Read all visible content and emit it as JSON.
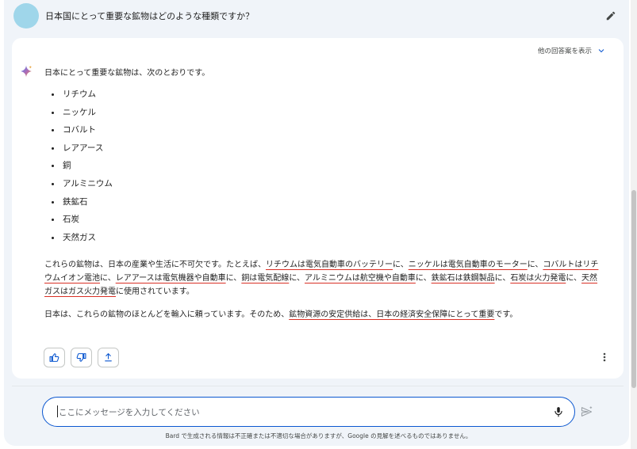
{
  "prompt": {
    "text": "日本国にとって重要な鉱物はどのような種類ですか？"
  },
  "response": {
    "show_drafts_label": "他の回答案を表示",
    "intro": "日本にとって重要な鉱物は、次のとおりです。",
    "minerals": [
      "リチウム",
      "ニッケル",
      "コバルト",
      "レアアース",
      "銅",
      "アルミニウム",
      "鉄鉱石",
      "石炭",
      "天然ガス"
    ],
    "para1": [
      {
        "t": "これらの鉱物は、日本の産業や生活に不可欠です。たとえば、",
        "u": false
      },
      {
        "t": "リチウムは電気自動車のバッテリー",
        "u": true
      },
      {
        "t": "に、",
        "u": false
      },
      {
        "t": "ニッケルは電気自動車のモーター",
        "u": true
      },
      {
        "t": "に、",
        "u": false
      },
      {
        "t": "コバルトはリチウムイオン電池",
        "u": true
      },
      {
        "t": "に、",
        "u": false
      },
      {
        "t": "レアアースは電気機器や自動車",
        "u": true
      },
      {
        "t": "に、",
        "u": false
      },
      {
        "t": "銅は電気配線",
        "u": true
      },
      {
        "t": "に、",
        "u": false
      },
      {
        "t": "アルミニウムは航空機や自動車",
        "u": true
      },
      {
        "t": "に、",
        "u": false
      },
      {
        "t": "鉄鉱石は鉄鋼製品",
        "u": true
      },
      {
        "t": "に、",
        "u": false
      },
      {
        "t": "石炭は火力発電",
        "u": true
      },
      {
        "t": "に、",
        "u": false
      },
      {
        "t": "天然ガスはガス火力発電",
        "u": true
      },
      {
        "t": "に使用されています。",
        "u": false
      }
    ],
    "para2": [
      {
        "t": "日本は、これらの鉱物のほとんどを輸入に頼っています。そのため、",
        "u": false
      },
      {
        "t": "鉱物資源の安定供給は、日本の経済安全保障にとって重要",
        "u": true
      },
      {
        "t": "です。",
        "u": false
      }
    ]
  },
  "input": {
    "placeholder": "ここにメッセージを入力してください"
  },
  "disclaimer": "Bard で生成される情報は不正確または不適切な場合がありますが、Google の見解を述べるものではありません。",
  "colors": {
    "accent": "#0b57d0",
    "underline": "#d93025",
    "background": "#f0f4f9",
    "avatar": "#9fd6ea"
  },
  "icons": [
    "edit-icon",
    "chevron-down-icon",
    "sparkle-icon",
    "thumbs-up-icon",
    "thumbs-down-icon",
    "share-icon",
    "more-vert-icon",
    "mic-icon",
    "send-icon"
  ]
}
